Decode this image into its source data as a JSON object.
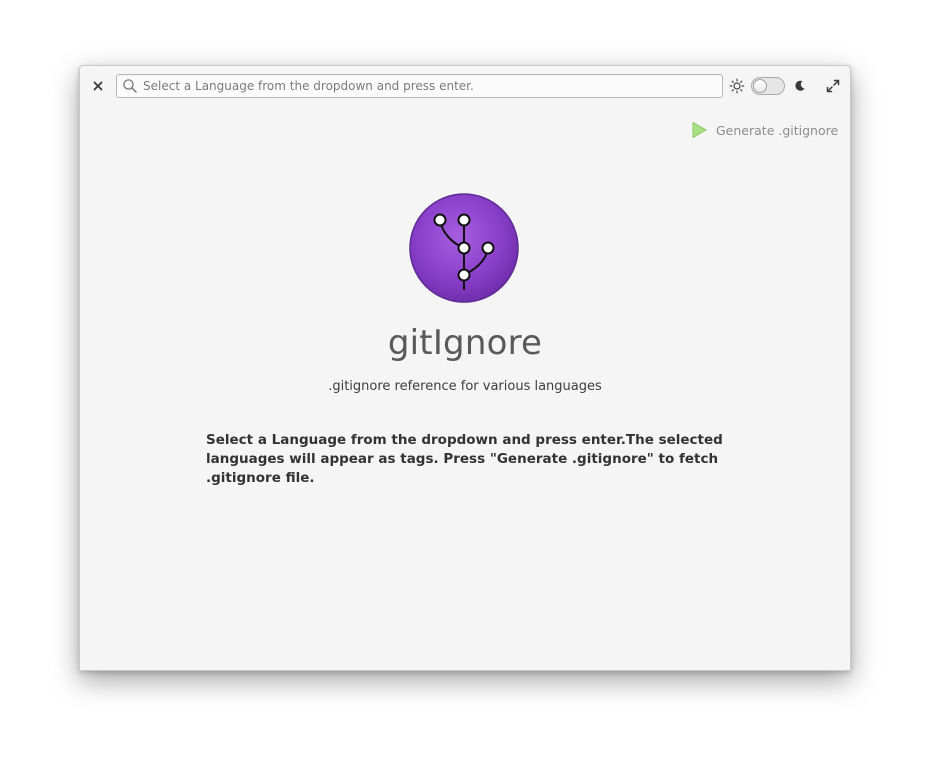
{
  "window": {
    "close_icon": "close-icon",
    "maximize_icon": "maximize-icon"
  },
  "search": {
    "placeholder": "Select a Language from the dropdown and press enter.",
    "value": "",
    "icon": "search-icon"
  },
  "theme_toggle": {
    "light_icon": "sun-icon",
    "dark_icon": "moon-icon",
    "dark_mode": false
  },
  "toolbar": {
    "generate_label": "Generate .gitignore",
    "generate_icon": "play-icon",
    "generate_icon_color": "#8fd35a"
  },
  "main": {
    "app_name": "gitIgnore",
    "subtitle": ".gitignore reference for various languages",
    "instructions": "Select a Language from the dropdown and press enter.The selected languages will appear as tags. Press \"Generate .gitignore\" to fetch .gitignore file.",
    "logo_icon": "git-branch-logo",
    "logo_color": "#8237c6"
  }
}
